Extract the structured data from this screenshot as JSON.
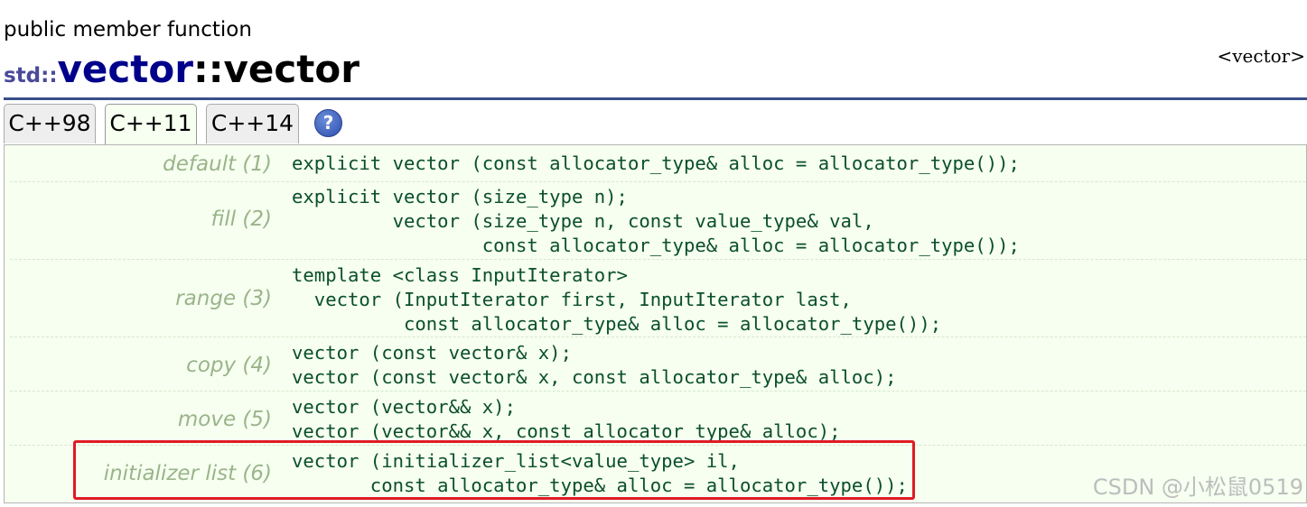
{
  "page": {
    "kind": "public member function",
    "namespace": "std::",
    "class_name": "vector",
    "separator": "::",
    "function_name": "vector",
    "header": "<vector>"
  },
  "tabs": [
    {
      "label": "C++98",
      "active": false
    },
    {
      "label": "C++11",
      "active": true
    },
    {
      "label": "C++14",
      "active": false
    }
  ],
  "help_icon": "?",
  "constructors": [
    {
      "label": "default (1)",
      "code": "explicit vector (const allocator_type& alloc = allocator_type());"
    },
    {
      "label": "fill (2)",
      "code": "explicit vector (size_type n);\n         vector (size_type n, const value_type& val,\n                 const allocator_type& alloc = allocator_type());"
    },
    {
      "label": "range (3)",
      "code": "template <class InputIterator>\n  vector (InputIterator first, InputIterator last,\n          const allocator_type& alloc = allocator_type());"
    },
    {
      "label": "copy (4)",
      "code": "vector (const vector& x);\nvector (const vector& x, const allocator_type& alloc);"
    },
    {
      "label": "move (5)",
      "code": "vector (vector&& x);\nvector (vector&& x, const allocator_type& alloc);"
    },
    {
      "label": "initializer list (6)",
      "code": "vector (initializer_list<value_type> il,\n       const allocator_type& alloc = allocator_type());"
    }
  ],
  "watermark": "CSDN @小松鼠0519",
  "colors": {
    "rule": "#3a4f8a",
    "panel_bg": "#f6fff0",
    "label": "#9ab48a",
    "code": "#0b4f2b",
    "highlight": "#e01b24"
  }
}
